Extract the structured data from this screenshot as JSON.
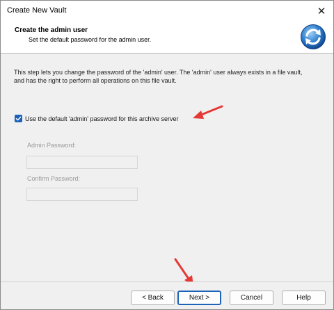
{
  "window": {
    "title": "Create New Vault",
    "close_glyph": "✕"
  },
  "header": {
    "title": "Create the admin user",
    "subtitle": "Set the default password for the admin user.",
    "logo_icon": "vault-refresh-icon"
  },
  "content": {
    "description": "This step lets you change the password of the 'admin' user. The 'admin' user always exists in a file vault, and has the right to perform all operations on this file vault.",
    "use_default_checkbox": {
      "label": "Use the default 'admin' password for this archive server",
      "checked": true
    },
    "admin_password": {
      "label": "Admin Password:",
      "value": "",
      "enabled": false
    },
    "confirm_password": {
      "label": "Confirm Password:",
      "value": "",
      "enabled": false
    }
  },
  "footer": {
    "back_label": "< Back",
    "next_label": "Next >",
    "cancel_label": "Cancel",
    "help_label": "Help"
  },
  "colors": {
    "accent": "#1b62b8",
    "annotation_arrow": "#e53935"
  }
}
